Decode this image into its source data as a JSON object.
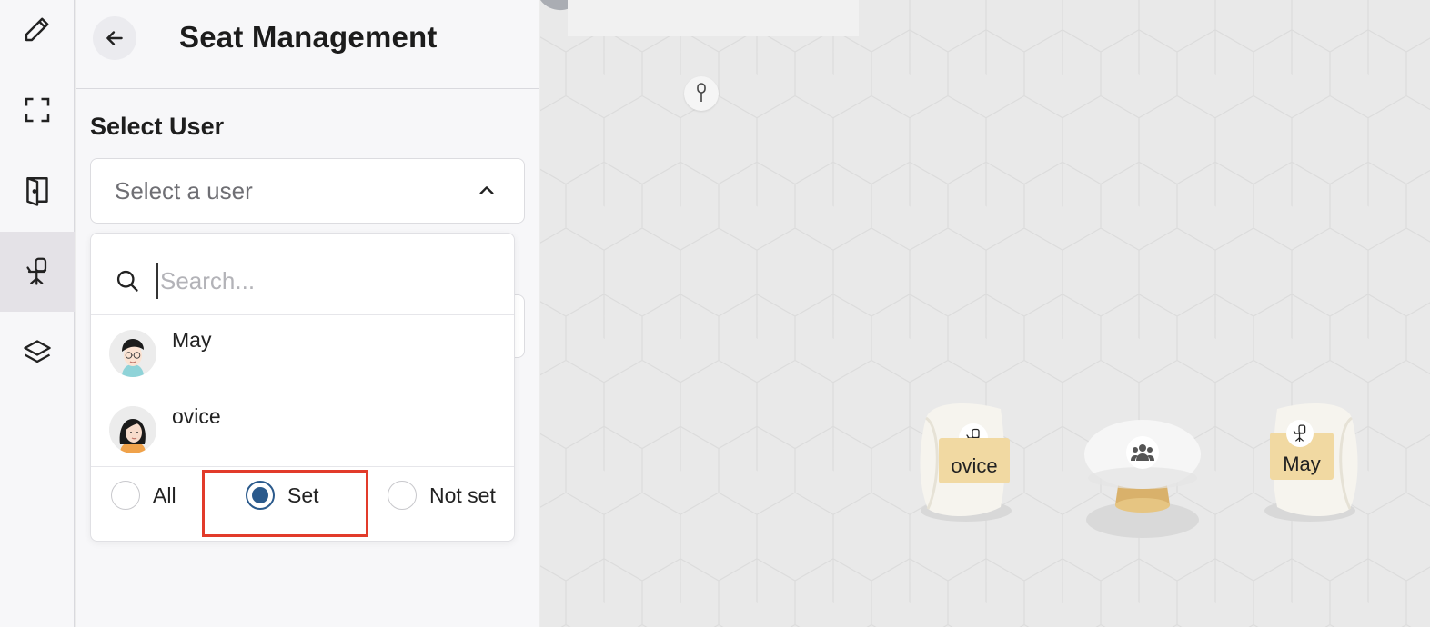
{
  "rail": {
    "items": [
      {
        "name": "edit",
        "icon": "pencil-icon"
      },
      {
        "name": "fullscreen",
        "icon": "fullscreen-icon"
      },
      {
        "name": "door",
        "icon": "door-icon"
      },
      {
        "name": "seat",
        "icon": "office-chair-icon",
        "active": true
      },
      {
        "name": "layers",
        "icon": "layers-icon"
      }
    ]
  },
  "panel": {
    "title": "Seat Management",
    "select_user_label": "Select User",
    "select_placeholder": "Select a user"
  },
  "dropdown": {
    "search_placeholder": "Search...",
    "users": [
      {
        "name": "May"
      },
      {
        "name": "ovice"
      }
    ],
    "filters": [
      {
        "label": "All",
        "checked": false
      },
      {
        "label": "Set",
        "checked": true
      },
      {
        "label": "Not set",
        "checked": false
      }
    ]
  },
  "canvas": {
    "seats": [
      {
        "label": "ovice"
      },
      {
        "label": "May"
      }
    ]
  },
  "colors": {
    "accent": "#2b5a8c",
    "highlight": "#e23b2a",
    "seat_label_bg": "#f1d9a2"
  }
}
